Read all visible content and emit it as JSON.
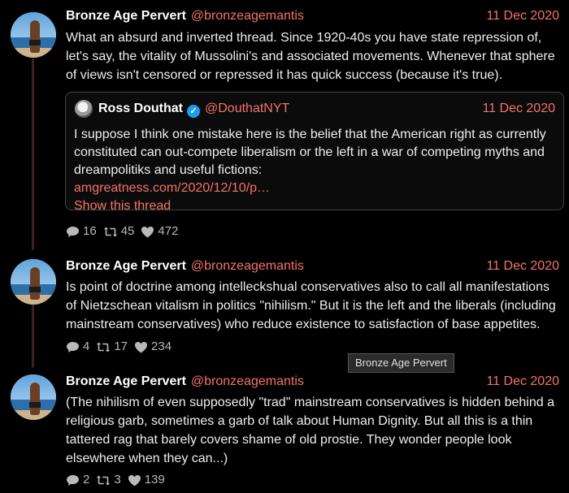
{
  "tweets": [
    {
      "author_name": "Bronze Age Pervert",
      "author_handle": "@bronzeagemantis",
      "date": "11 Dec 2020",
      "text": "What an absurd and inverted thread. Since 1920-40s you have state repression of, let's say, the vitality of Mussolini's and associated movements. Whenever that sphere of views isn't censored or repressed it has quick success (because it's true).",
      "quote": {
        "author_name": "Ross Douthat",
        "author_handle": "@DouthatNYT",
        "date": "11 Dec 2020",
        "text": "I suppose I think one mistake here is the belief that the American right as currently constituted can out-compete liberalism or the left in a war of competing myths and dreampolitiks and useful fictions:",
        "link": "amgreatness.com/2020/12/10/p…",
        "show_thread": "Show this thread"
      },
      "replies": "16",
      "retweets": "45",
      "likes": "472"
    },
    {
      "author_name": "Bronze Age Pervert",
      "author_handle": "@bronzeagemantis",
      "date": "11 Dec 2020",
      "text": "Is point of doctrine among intelleckshual conservatives also to call all manifestations of Nietzschean vitalism in politics \"nihilism.\" But it is the left and the liberals (including mainstream conservatives) who reduce existence to satisfaction of base appetites.",
      "replies": "4",
      "retweets": "17",
      "likes": "234"
    },
    {
      "author_name": "Bronze Age Pervert",
      "author_handle": "@bronzeagemantis",
      "date": "11 Dec 2020",
      "text": "(The nihilism of even supposedly \"trad\" mainstream conservatives is hidden behind a religious garb, sometimes a garb of talk about Human Dignity. But all this is a thin tattered rag that barely covers shame of old prostie. They wonder people look elsewhere when they can...)",
      "replies": "2",
      "retweets": "3",
      "likes": "139"
    }
  ],
  "tooltip": "Bronze Age Pervert",
  "icons": {
    "reply": "reply-icon",
    "retweet": "retweet-icon",
    "like": "heart-icon",
    "verified": "verified-badge-icon"
  },
  "colors": {
    "accent": "#f4736a",
    "background": "#000000",
    "verified": "#1d9bf0"
  }
}
